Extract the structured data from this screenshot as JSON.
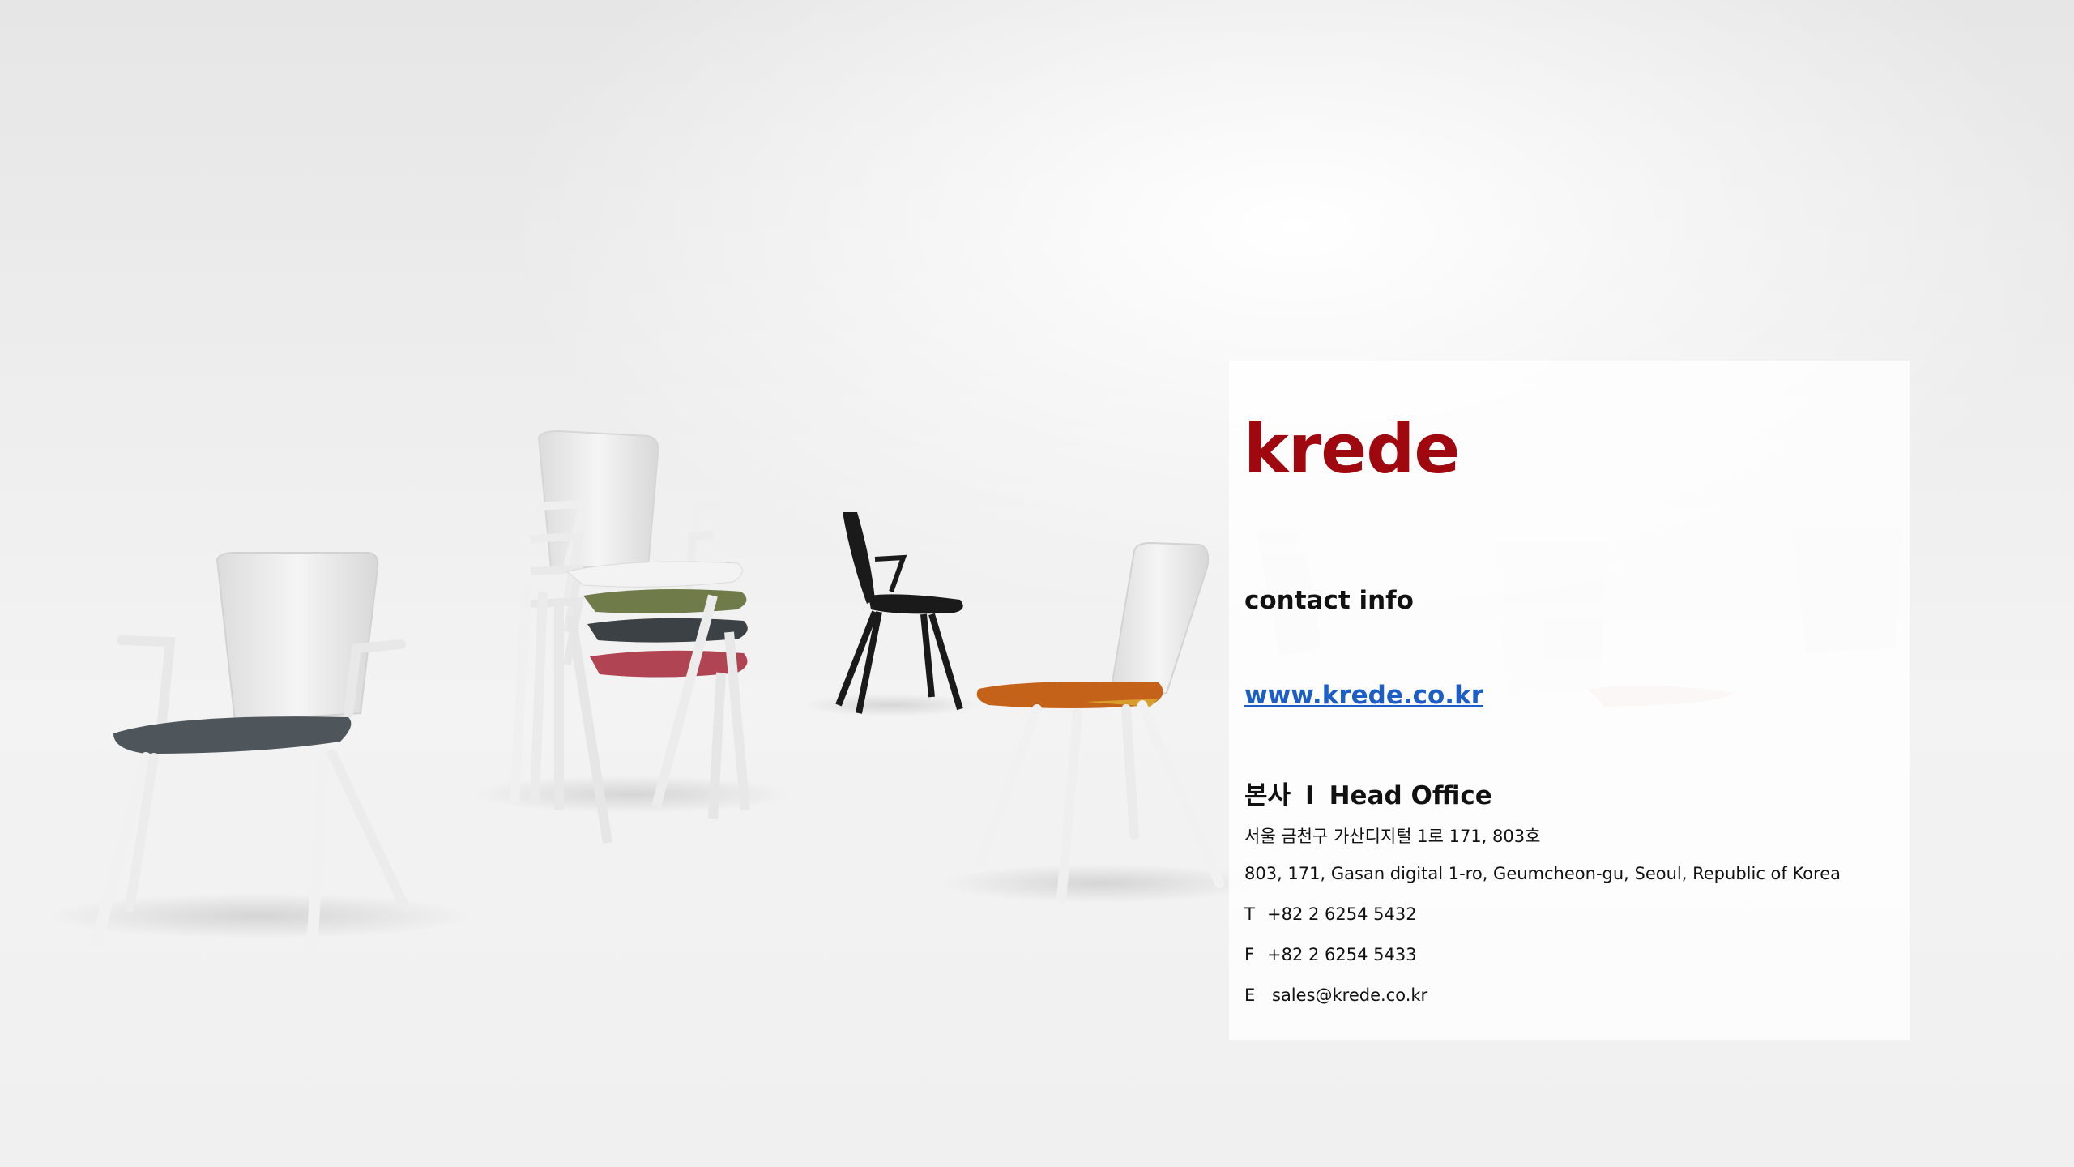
{
  "brand": {
    "name": "krede",
    "color": "#a0080f"
  },
  "contact": {
    "heading": "contact info",
    "website": "www.krede.co.kr",
    "office_heading_kr": "본사",
    "office_sep": "I",
    "office_heading_en": "Head Office",
    "address_kr": "서울 금천구 가산디지털 1로 171, 803호",
    "address_en": "803, 171, Gasan digital 1-ro, Geumcheon-gu, Seoul, Republic of Korea",
    "phone_label": "T",
    "phone": "+82 2 6254 5432",
    "fax_label": "F",
    "fax": "+82 2 6254 5433",
    "email_label": "E",
    "email": "sales@krede.co.kr"
  },
  "colors": {
    "link": "#1c5ec6",
    "seat_gray": "#4e565c",
    "seat_green": "#6f7c4a",
    "seat_dark": "#3c4146",
    "seat_red": "#b14452",
    "seat_orange": "#c5621a",
    "chair_black": "#1a1a1a"
  }
}
